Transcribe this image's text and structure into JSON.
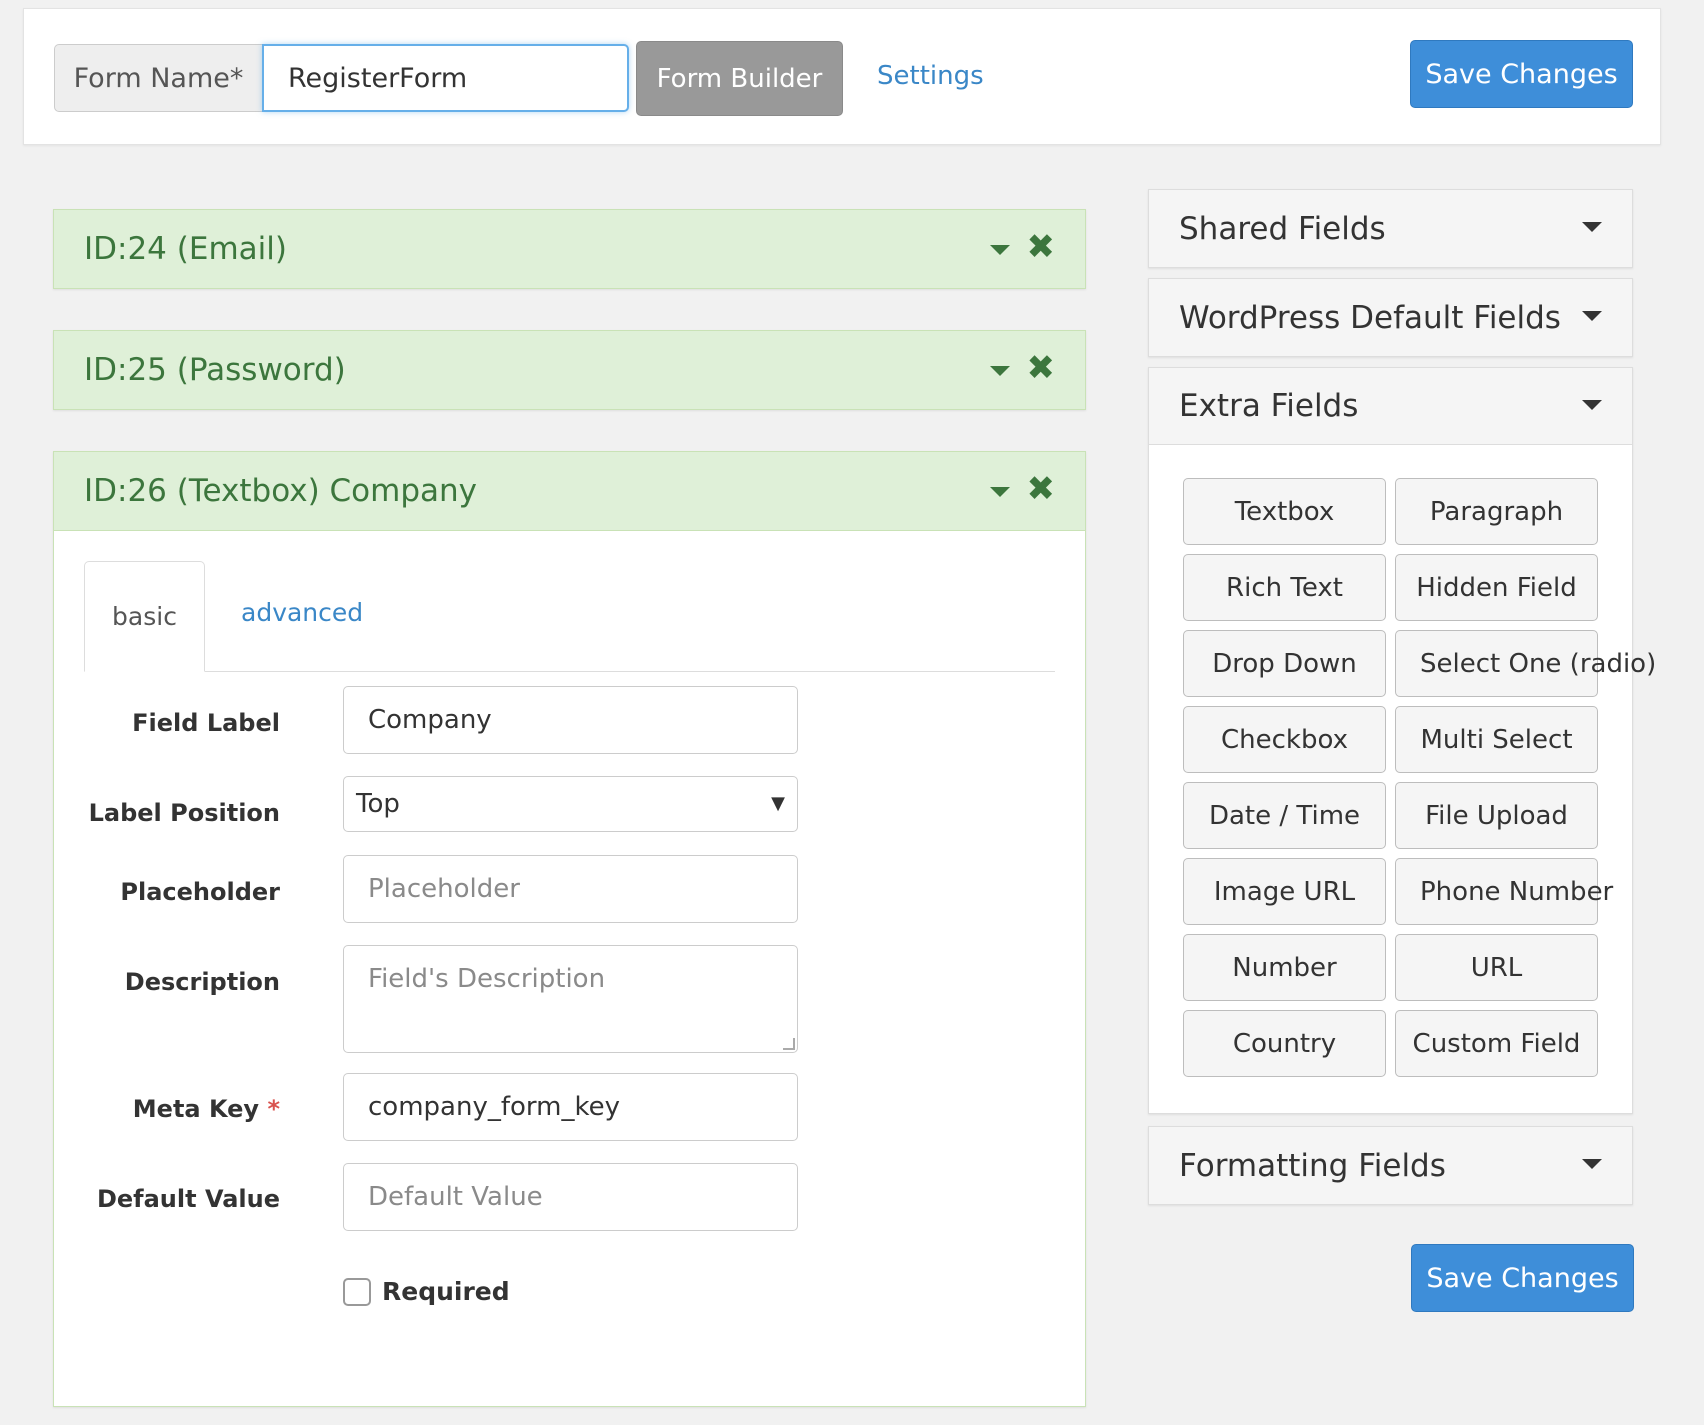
{
  "header": {
    "form_name_label": "Form Name*",
    "form_name_value": "RegisterForm",
    "form_builder_label": "Form Builder",
    "settings_label": "Settings",
    "save_label": "Save Changes"
  },
  "fields": [
    {
      "title": "ID:24 (Email)"
    },
    {
      "title": "ID:25 (Password)"
    },
    {
      "title": "ID:26 (Textbox) Company"
    }
  ],
  "field_editor": {
    "tabs": {
      "basic": "basic",
      "advanced": "advanced"
    },
    "field_label": {
      "label": "Field Label",
      "value": "Company"
    },
    "label_position": {
      "label": "Label Position",
      "value": "Top"
    },
    "placeholder": {
      "label": "Placeholder",
      "placeholder": "Placeholder"
    },
    "description": {
      "label": "Description",
      "placeholder": "Field's Description"
    },
    "meta_key": {
      "label": "Meta Key",
      "required_mark": "*",
      "value": "company_form_key"
    },
    "default_value": {
      "label": "Default Value",
      "placeholder": "Default Value"
    },
    "required": {
      "label": "Required",
      "checked": false
    }
  },
  "sidebar": {
    "shared": "Shared Fields",
    "wp_default": "WordPress Default Fields",
    "extra": "Extra Fields",
    "formatting": "Formatting Fields",
    "extra_buttons": [
      "Textbox",
      "Paragraph",
      "Rich Text",
      "Hidden Field",
      "Drop Down",
      "Select One (radio)",
      "Checkbox",
      "Multi Select",
      "Date / Time",
      "File Upload",
      "Image URL",
      "Phone Number",
      "Number",
      "URL",
      "Country",
      "Custom Field"
    ],
    "save_label": "Save Changes"
  },
  "colors": {
    "accent": "#3e8ed9",
    "field_header_bg": "#dff0d8",
    "field_header_text": "#3c763d"
  }
}
